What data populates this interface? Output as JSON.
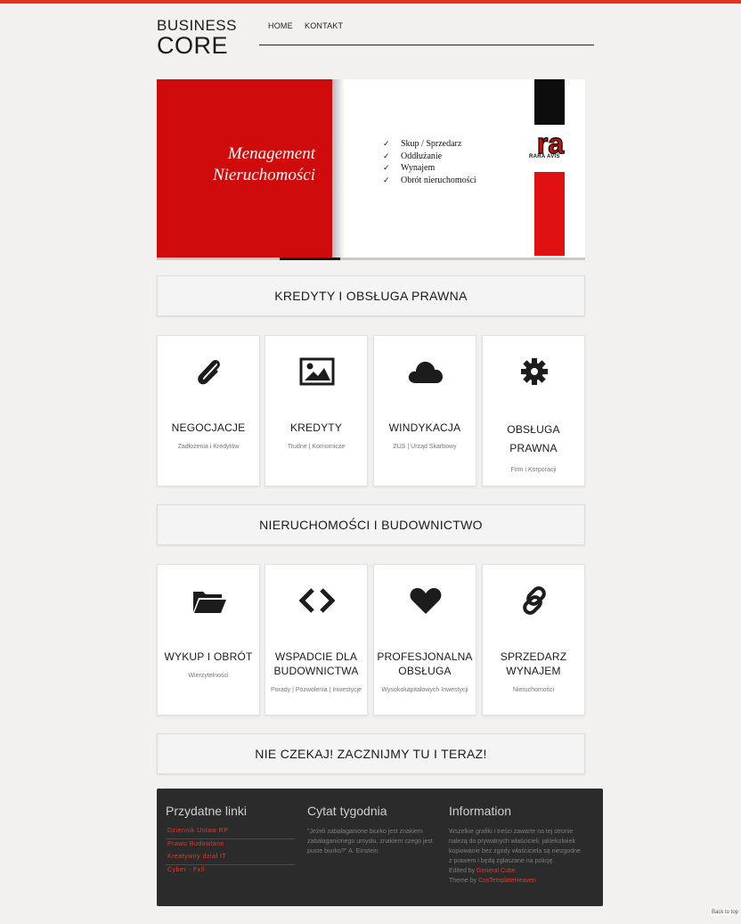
{
  "logo": {
    "line1": "BUSINESS",
    "line2": "CORE"
  },
  "nav": {
    "items": [
      "HOME",
      "KONTAKT"
    ]
  },
  "slider": {
    "headline_line1": "Menagement",
    "headline_line2": "Nieruchomości",
    "checks": [
      "Skup / Sprzedarz",
      "Oddłużanie",
      "Wynajem",
      "Obrót nieruchomości"
    ],
    "tick": "✓",
    "brand_letters": "ra",
    "brand": "RARA AVIS"
  },
  "sections": [
    {
      "title": "KREDYTY I OBSŁUGA PRAWNA",
      "cards": [
        {
          "icon": "paperclip-icon",
          "title": "NEGOCJACJE",
          "sub": "Zadłożenia i Kredytów"
        },
        {
          "icon": "image-icon",
          "title": "KREDYTY",
          "sub": "Trudne | Komornicze"
        },
        {
          "icon": "cloud-icon",
          "title": "WINDYKACJA",
          "sub": "ZUS | Urząd Skarbowy"
        },
        {
          "icon": "gear-icon",
          "title": "OBSŁUGA PRAWNA",
          "sub": "Firm i Korporacji"
        }
      ]
    },
    {
      "title": "NIERUCHOMOŚCI I BUDOWNICTWO",
      "cards": [
        {
          "icon": "folder-icon",
          "title": "WYKUP I OBRÓT",
          "sub": "Wierzytelności"
        },
        {
          "icon": "code-icon",
          "title": "WSPADCIE DLA BUDOWNICTWA",
          "sub": "Porady | Pozwolenia | Inwestycje"
        },
        {
          "icon": "heart-icon",
          "title": "PROFESJONALNA OBSŁUGA",
          "sub": "Wysokokapitałowych Inwestycji"
        },
        {
          "icon": "link-icon",
          "title": "SPRZEDARZ WYNAJEM",
          "sub": "Nieruchomości"
        }
      ]
    }
  ],
  "cta": "NIE CZEKAJ! ZACZNIJMY TU I TERAZ!",
  "footer": {
    "links_title": "Przydatne linki",
    "links": [
      "Dziennik Ustaw RP",
      "Prawo Budowlane",
      "Kreatywny dział IT",
      "Cyber - Fxll"
    ],
    "quote_title": "Cytat tygodnia",
    "quote": "\"Jeżeli zabałaganione biurko jest znakiem zabałaganionego umysłu, znakiem czego jest puste biurko?\" A. Einstein",
    "info_title": "Information",
    "info": "Wszelkie grafiki i treści zawarte na tej stronie należą do prywatnych właścicieli, jakiekolwiek kopiowanie bez zgody właściciela są niezgodne z prawem i będą zgłaszane na policję.",
    "edited_by_label": "Edited by",
    "edited_by": "General Cube",
    "theme_by_label": "Theme by",
    "theme_by": "CssTemplateHeaven"
  },
  "back_to_top": "Back to top",
  "colors": {
    "accent": "#e8321f",
    "slide_red": "#cf0b0b",
    "footer_bg": "#2b2b2b"
  }
}
